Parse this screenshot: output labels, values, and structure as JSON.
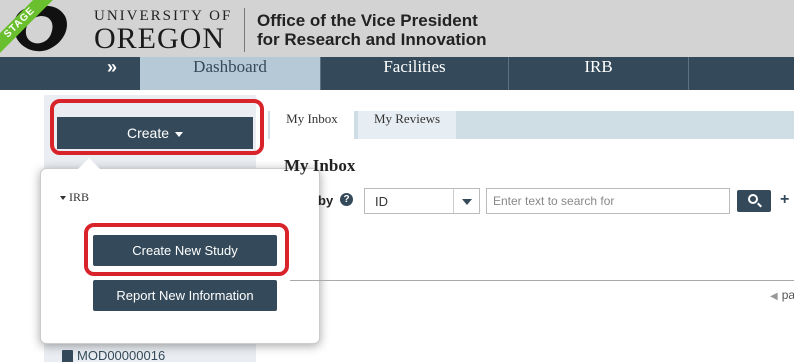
{
  "header": {
    "stage_label": "STAGE",
    "university_top": "UNIVERSITY OF",
    "university_bottom": "OREGON",
    "office_line1": "Office of the Vice President",
    "office_line2": "for Research and Innovation"
  },
  "nav": {
    "expand_label": "»",
    "items": [
      {
        "label": "Dashboard"
      },
      {
        "label": "Facilities"
      },
      {
        "label": "IRB"
      },
      {
        "label": ""
      }
    ]
  },
  "sidebar": {
    "create_label": "Create",
    "popup": {
      "section_label": "IRB",
      "create_study_label": "Create New Study",
      "report_info_label": "Report New Information"
    },
    "list_item_label": "MOD00000016"
  },
  "main": {
    "tabs": [
      {
        "label": "My Inbox"
      },
      {
        "label": "My Reviews"
      }
    ],
    "title": "My Inbox",
    "filter_label": "by",
    "filter_selected": "ID",
    "search_placeholder": "Enter text to search for",
    "add_symbol": "+",
    "pager_label": "pa"
  },
  "colors": {
    "nav_bg": "#344a5a",
    "nav_active_bg": "#b5cad6",
    "highlight": "#d8232a",
    "stage_ribbon": "#6abf2e"
  }
}
